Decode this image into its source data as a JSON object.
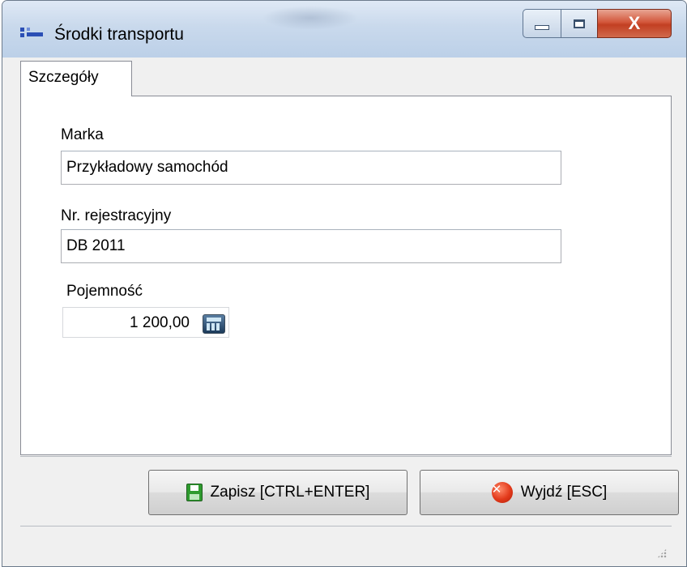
{
  "window": {
    "title": "Środki transportu",
    "icon": "app-window-icon",
    "controls": {
      "minimize": "minimize-icon",
      "maximize": "maximize-icon",
      "close": "X"
    }
  },
  "tabs": [
    {
      "label": "Szczegóły",
      "active": true
    }
  ],
  "form": {
    "marka": {
      "label": "Marka",
      "value": "Przykładowy samochód"
    },
    "nr_rejestracyjny": {
      "label": "Nr. rejestracyjny",
      "value": "DB 2011"
    },
    "pojemnosc": {
      "label": "Pojemność",
      "value": "1 200,00",
      "calculator_icon": "calculator-icon"
    }
  },
  "buttons": {
    "save": {
      "label": "Zapisz [CTRL+ENTER]",
      "icon": "floppy-disk-icon"
    },
    "exit": {
      "label": "Wyjdź [ESC]",
      "icon": "close-circle-icon"
    }
  },
  "colors": {
    "titlebar": "#c9d9ec",
    "close_button": "#c94a2e",
    "save_icon": "#2f9b2f",
    "exit_icon": "#e2391a"
  }
}
